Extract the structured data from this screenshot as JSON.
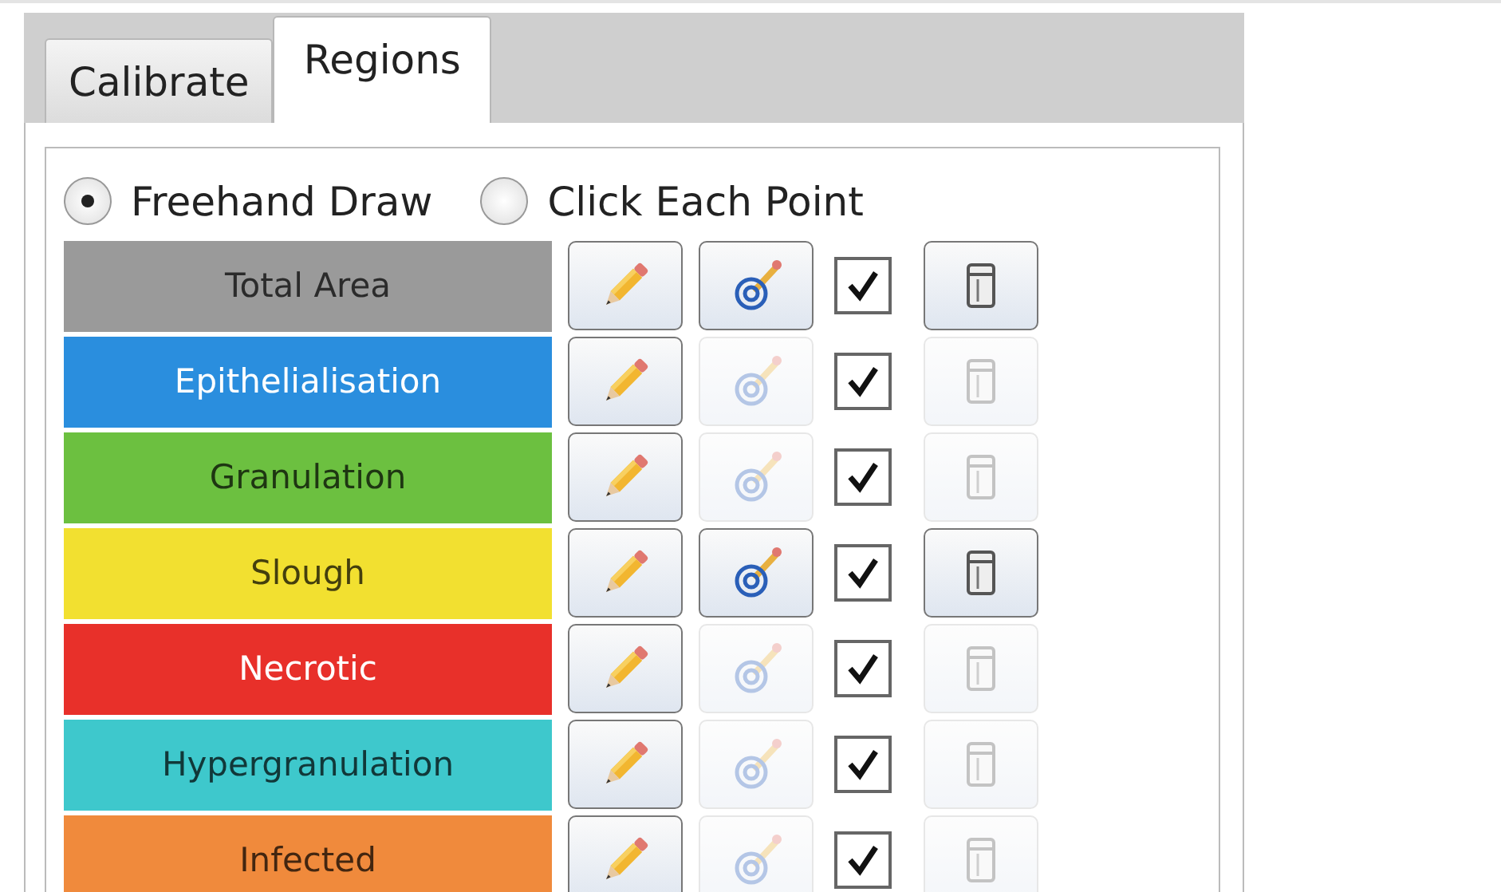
{
  "tabs": [
    {
      "label": "Calibrate",
      "selected": false
    },
    {
      "label": "Regions",
      "selected": true
    }
  ],
  "draw_modes": [
    {
      "label": "Freehand Draw",
      "selected": true
    },
    {
      "label": "Click Each Point",
      "selected": false
    }
  ],
  "regions": [
    {
      "name": "Total Area",
      "color": "#9a9a9a",
      "target_enabled": true,
      "checked": true,
      "delete_enabled": true
    },
    {
      "name": "Epithelialisation",
      "color": "#2a8ede",
      "target_enabled": false,
      "checked": true,
      "delete_enabled": false
    },
    {
      "name": "Granulation",
      "color": "#6cc040",
      "target_enabled": false,
      "checked": true,
      "delete_enabled": false
    },
    {
      "name": "Slough",
      "color": "#f2e030",
      "target_enabled": true,
      "checked": true,
      "delete_enabled": true
    },
    {
      "name": "Necrotic",
      "color": "#e8302a",
      "target_enabled": false,
      "checked": true,
      "delete_enabled": false
    },
    {
      "name": "Hypergranulation",
      "color": "#3ec8cc",
      "target_enabled": false,
      "checked": true,
      "delete_enabled": false
    },
    {
      "name": "Infected",
      "color": "#f08a3c",
      "target_enabled": false,
      "checked": true,
      "delete_enabled": false
    }
  ]
}
